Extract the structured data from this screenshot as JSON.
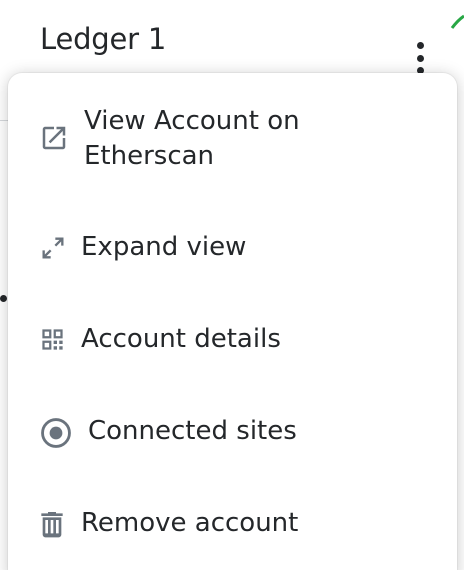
{
  "header": {
    "account_name": "Ledger 1"
  },
  "menu": {
    "items": [
      {
        "label": "View Account on",
        "label_line2": "Etherscan",
        "icon": "external-link-icon"
      },
      {
        "label": "Expand view",
        "icon": "expand-icon"
      },
      {
        "label": "Account details",
        "icon": "qr-code-icon"
      },
      {
        "label": "Connected sites",
        "icon": "connected-sites-icon"
      },
      {
        "label": "Remove account",
        "icon": "trash-icon"
      }
    ]
  },
  "colors": {
    "text": "#24272a",
    "icon": "#6a737d",
    "background": "#ffffff"
  }
}
